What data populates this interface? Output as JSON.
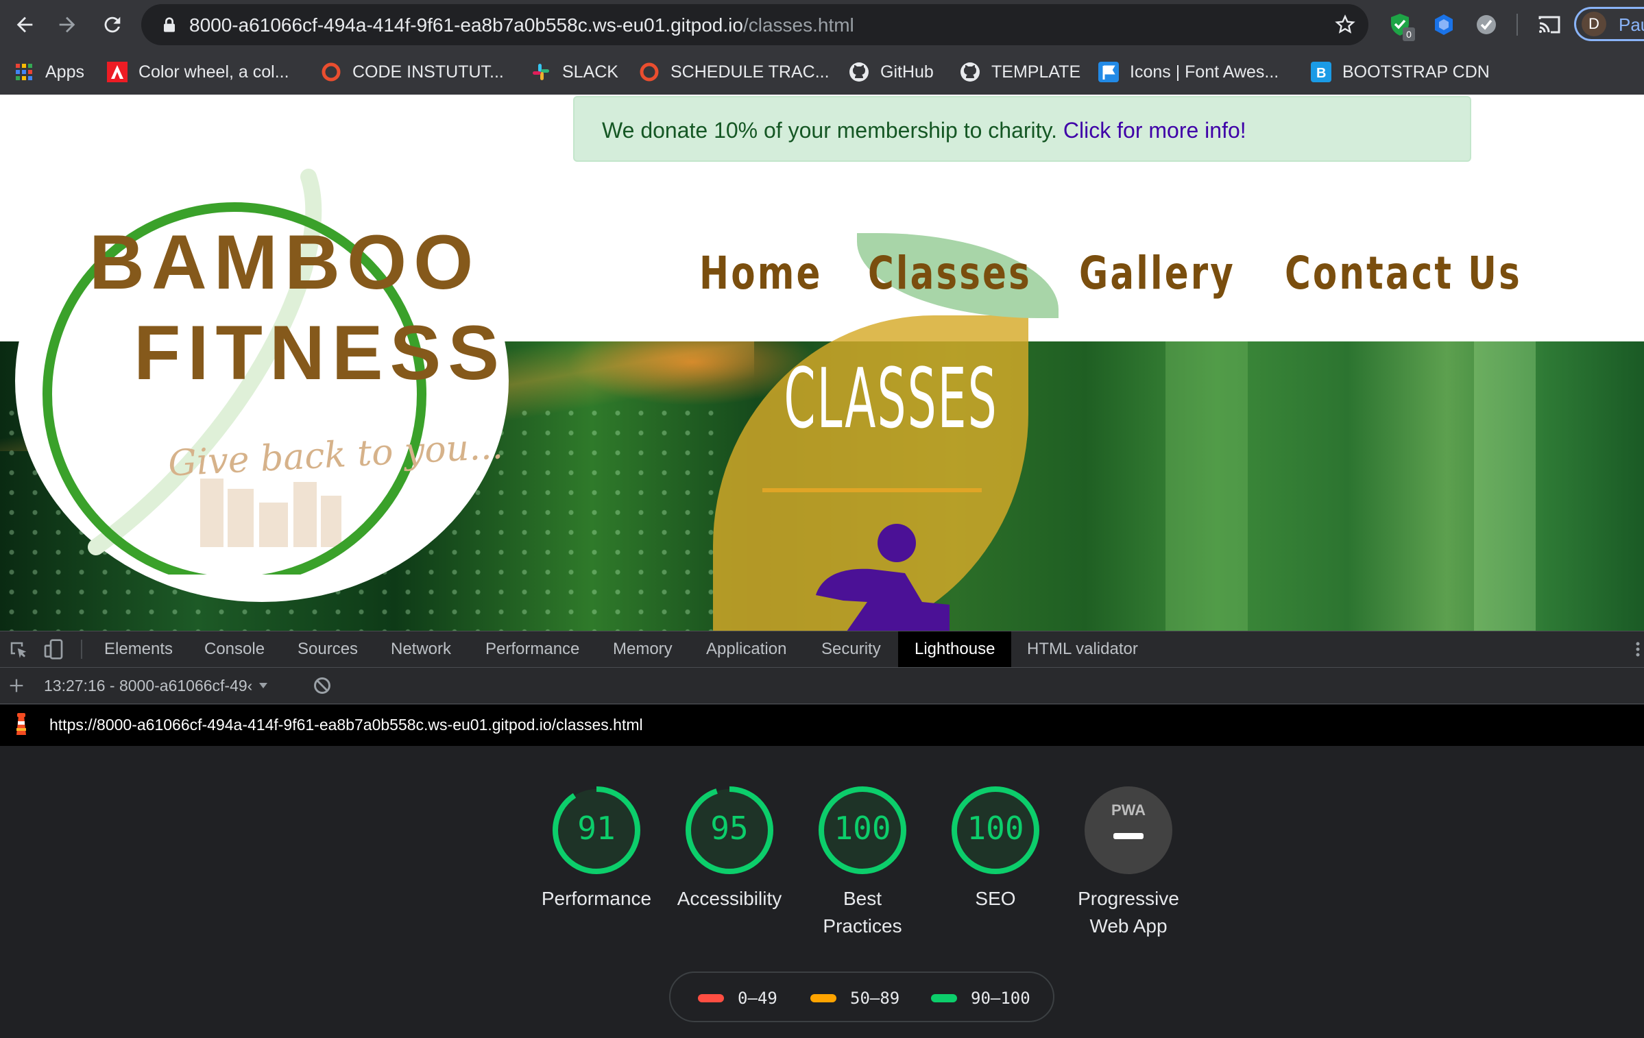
{
  "browser": {
    "url_main": "8000-a61066cf-494a-414f-9f61-ea8b7a0b558c.ws-eu01.gitpod.io",
    "url_path": "/classes.html",
    "extension_badge": "0",
    "profile_initial": "D",
    "profile_name": "Pau",
    "bookmarks": [
      {
        "label": "Apps",
        "icon": "apps-grid-icon"
      },
      {
        "label": "Color wheel, a col...",
        "icon": "adobe-icon"
      },
      {
        "label": "CODE INSTUTUT...",
        "icon": "red-circle-icon"
      },
      {
        "label": "SLACK",
        "icon": "slack-icon"
      },
      {
        "label": "SCHEDULE TRAC...",
        "icon": "red-circle-icon"
      },
      {
        "label": "GitHub",
        "icon": "github-icon"
      },
      {
        "label": "TEMPLATE",
        "icon": "github-icon"
      },
      {
        "label": "Icons | Font Awes...",
        "icon": "font-awesome-flag-icon"
      },
      {
        "label": "BOOTSTRAP CDN",
        "icon": "bootstrap-icon"
      }
    ]
  },
  "site": {
    "banner_text": "We donate 10% of your membership to charity. ",
    "banner_link": "Click for more info!",
    "logo_line1": "BAMBOO",
    "logo_line2": "FITNESS",
    "logo_tagline": "Give back to you...",
    "nav": [
      "Home",
      "Classes",
      "Gallery",
      "Contact Us"
    ],
    "active_nav": "Classes",
    "page_heading": "CLASSES",
    "colors": {
      "brand_brown": "#85591b",
      "logo_green": "#3aa12a",
      "leaf_gold": "#d6aa28",
      "runner_purple": "#4b1196",
      "banner_bg": "#d4edda"
    }
  },
  "devtools": {
    "tabs": [
      "Elements",
      "Console",
      "Sources",
      "Network",
      "Performance",
      "Memory",
      "Application",
      "Security",
      "Lighthouse",
      "HTML validator"
    ],
    "active_tab": "Lighthouse",
    "report_select": "13:27:16 - 8000-a61066cf-49‹",
    "report_url": "https://8000-a61066cf-494a-414f-9f61-ea8b7a0b558c.ws-eu01.gitpod.io/classes.html",
    "scores": [
      {
        "label": "Performance",
        "value": "91",
        "fraction": 0.91
      },
      {
        "label": "Accessibility",
        "value": "95",
        "fraction": 0.95
      },
      {
        "label": "Best Practices",
        "value": "100",
        "fraction": 1.0
      },
      {
        "label": "SEO",
        "value": "100",
        "fraction": 1.0
      }
    ],
    "pwa": {
      "label": "Progressive Web App",
      "badge": "PWA"
    },
    "legend": [
      {
        "range": "0–49",
        "color": "#ff4e42"
      },
      {
        "range": "50–89",
        "color": "#ffa400"
      },
      {
        "range": "90–100",
        "color": "#0cce6b"
      }
    ]
  }
}
